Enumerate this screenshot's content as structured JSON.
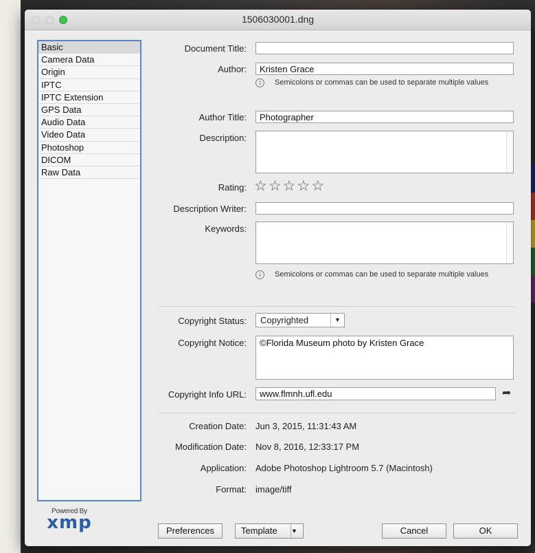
{
  "window": {
    "title": "1506030001.dng"
  },
  "sidebar": {
    "items": [
      {
        "label": "Basic",
        "active": true
      },
      {
        "label": "Camera Data"
      },
      {
        "label": "Origin"
      },
      {
        "label": "IPTC"
      },
      {
        "label": "IPTC Extension"
      },
      {
        "label": "GPS Data"
      },
      {
        "label": "Audio Data"
      },
      {
        "label": "Video Data"
      },
      {
        "label": "Photoshop"
      },
      {
        "label": "DICOM"
      },
      {
        "label": "Raw Data"
      }
    ]
  },
  "branding": {
    "powered_by": "Powered By",
    "logo": "xmp"
  },
  "form": {
    "document_title": {
      "label": "Document Title:",
      "value": ""
    },
    "author": {
      "label": "Author:",
      "value": "Kristen Grace"
    },
    "author_hint": "Semicolons or commas can be used to separate multiple values",
    "author_title": {
      "label": "Author Title:",
      "value": "Photographer"
    },
    "description": {
      "label": "Description:",
      "value": ""
    },
    "rating": {
      "label": "Rating:",
      "value": 0,
      "max": 5,
      "star_glyph": "☆"
    },
    "description_writer": {
      "label": "Description Writer:",
      "value": ""
    },
    "keywords": {
      "label": "Keywords:",
      "value": ""
    },
    "keywords_hint": "Semicolons or commas can be used to separate multiple values",
    "info_icon_glyph": "i",
    "copyright_status": {
      "label": "Copyright Status:",
      "value": "Copyrighted"
    },
    "copyright_notice": {
      "label": "Copyright Notice:",
      "value": "©Florida Museum photo by Kristen Grace"
    },
    "copyright_url": {
      "label": "Copyright Info URL:",
      "value": "www.flmnh.ufl.edu",
      "go_glyph": "➦"
    },
    "creation_date": {
      "label": "Creation Date:",
      "value": "Jun 3, 2015, 11:31:43 AM"
    },
    "modification_date": {
      "label": "Modification Date:",
      "value": "Nov 8, 2016, 12:33:17 PM"
    },
    "application": {
      "label": "Application:",
      "value": "Adobe Photoshop Lightroom 5.7 (Macintosh)"
    },
    "format": {
      "label": "Format:",
      "value": "image/tiff"
    }
  },
  "buttons": {
    "preferences": "Preferences",
    "template": "Template",
    "cancel": "Cancel",
    "ok": "OK",
    "dropdown_glyph": "▼"
  },
  "colors": {
    "accent": "#5a86c4",
    "brand": "#2a5fa8",
    "zoom_green": "#37c948"
  }
}
